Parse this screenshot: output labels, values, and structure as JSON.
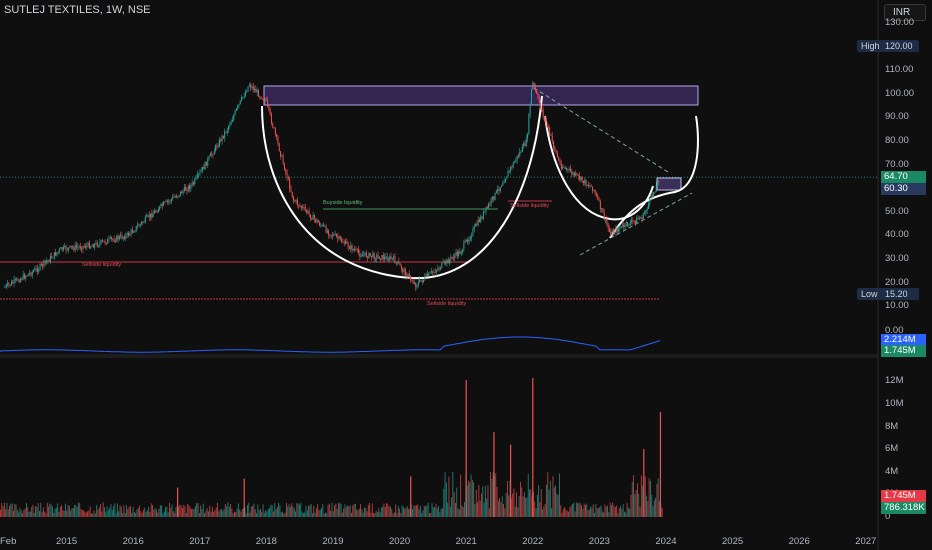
{
  "header": {
    "title": "SUTLEJ TEXTILES, 1W, NSE",
    "currency": "INR"
  },
  "price_axis": {
    "ticks": [
      "130.00",
      "120.00",
      "110.00",
      "100.00",
      "90.00",
      "80.00",
      "70.00",
      "60.00",
      "50.00",
      "40.00",
      "30.00",
      "20.00",
      "10.00"
    ]
  },
  "badges": {
    "high_label": "High",
    "high_value": "120.00",
    "low_label": "Low",
    "low_value": "15.20",
    "last_price": "64.70",
    "mid_price": "60.30"
  },
  "indicator": {
    "zero": "0.00",
    "value1": "2.214M",
    "value2": "1.745M"
  },
  "volume_axis": {
    "ticks": [
      "12M",
      "10M",
      "8M",
      "6M",
      "4M",
      "2M",
      "0"
    ],
    "value_red": "1.745M",
    "value_green": "786.318K"
  },
  "time_axis": {
    "labels": [
      "Feb",
      "2015",
      "2016",
      "2017",
      "2018",
      "2019",
      "2020",
      "2021",
      "2022",
      "2023",
      "2024",
      "2025",
      "2026",
      "2027"
    ]
  },
  "annotations": {
    "buyside": "Buyside liquidity",
    "sellside_low": "Sellside liquidity",
    "sellside_bottom": "Sellside liquidity",
    "sellside_right": "Sellside liquidity"
  },
  "chart_data": {
    "type": "candlestick",
    "series_points": [
      [
        "2014-02",
        18
      ],
      [
        "2014-08",
        26
      ],
      [
        "2014-12",
        34
      ],
      [
        "2015-06",
        36
      ],
      [
        "2015-12",
        40
      ],
      [
        "2016-06",
        52
      ],
      [
        "2016-12",
        62
      ],
      [
        "2017-06",
        85
      ],
      [
        "2017-10",
        104
      ],
      [
        "2018-01",
        97
      ],
      [
        "2018-06",
        55
      ],
      [
        "2018-12",
        42
      ],
      [
        "2019-06",
        32
      ],
      [
        "2019-12",
        30
      ],
      [
        "2020-04",
        19
      ],
      [
        "2020-12",
        33
      ],
      [
        "2021-06",
        56
      ],
      [
        "2021-12",
        80
      ],
      [
        "2022-01",
        105
      ],
      [
        "2022-06",
        70
      ],
      [
        "2022-12",
        60
      ],
      [
        "2023-03",
        41
      ],
      [
        "2023-09",
        48
      ],
      [
        "2023-12",
        64.7
      ]
    ],
    "ylim": [
      10,
      130
    ],
    "ylog": false,
    "volume_peaks": [
      [
        "2021-01",
        12.1
      ],
      [
        "2022-01",
        12.3
      ],
      [
        "2021-06",
        7.5
      ],
      [
        "2021-09",
        6.4
      ],
      [
        "2023-12",
        9.3
      ],
      [
        "2023-09",
        6.0
      ],
      [
        "2017-09",
        3.4
      ],
      [
        "2020-03",
        3.6
      ],
      [
        "2016-09",
        2.6
      ]
    ],
    "volume_ylim": [
      0,
      13
    ]
  }
}
